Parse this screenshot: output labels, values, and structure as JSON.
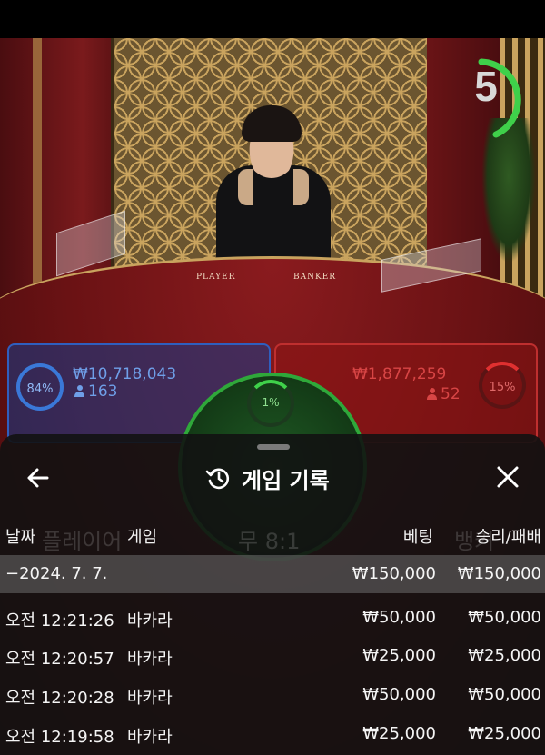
{
  "stream": {
    "countdown": "5",
    "table_labels": [
      "PLAYER",
      "BANKER"
    ]
  },
  "bets": {
    "player": {
      "percent": "84%",
      "amount": "₩10,718,043",
      "count": "163"
    },
    "banker": {
      "percent": "15%",
      "amount": "₩1,877,259",
      "count": "52"
    },
    "tie": {
      "percent": "1%"
    }
  },
  "history": {
    "title": "게임 기록",
    "columns": {
      "date": "날짜",
      "game": "게임",
      "bet": "베팅",
      "result": "승리/패배"
    },
    "date_group": {
      "label": "−2024. 7. 7.",
      "bet": "₩150,000",
      "result": "₩150,000"
    },
    "rows": [
      {
        "time": "오전 12:21:26",
        "game": "바카라",
        "bet": "₩50,000",
        "result": "₩50,000"
      },
      {
        "time": "오전 12:20:57",
        "game": "바카라",
        "bet": "₩25,000",
        "result": "₩25,000"
      },
      {
        "time": "오전 12:20:28",
        "game": "바카라",
        "bet": "₩50,000",
        "result": "₩50,000"
      },
      {
        "time": "오전 12:19:58",
        "game": "바카라",
        "bet": "₩25,000",
        "result": "₩25,000"
      }
    ]
  },
  "background_labels": {
    "player": "플레이어",
    "tie": "무 8:1",
    "banker": "뱅커"
  },
  "colors": {
    "player": "#2f5fbf",
    "banker": "#bf2f2f",
    "tie": "#2fa83a",
    "timer": "#3fd04a"
  }
}
